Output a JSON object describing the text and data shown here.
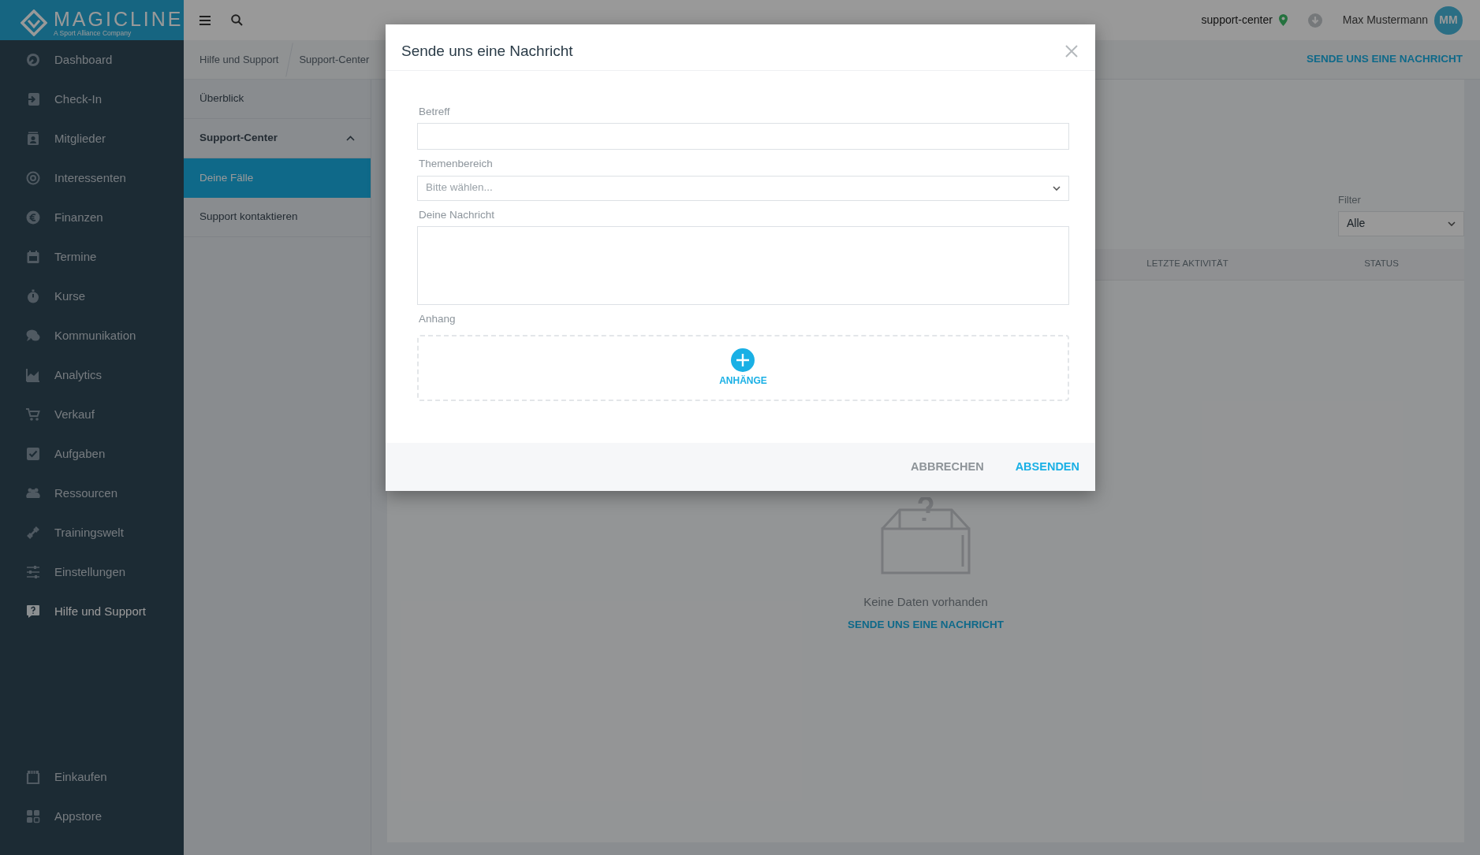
{
  "sidebar": {
    "logo": {
      "name": "MAGICLINE",
      "tagline": "A Sport Alliance Company"
    },
    "items": [
      {
        "label": "Dashboard",
        "selected": false
      },
      {
        "label": "Check-In",
        "selected": false
      },
      {
        "label": "Mitglieder",
        "selected": false
      },
      {
        "label": "Interessenten",
        "selected": false
      },
      {
        "label": "Finanzen",
        "selected": false
      },
      {
        "label": "Termine",
        "selected": false
      },
      {
        "label": "Kurse",
        "selected": false
      },
      {
        "label": "Kommunikation",
        "selected": false
      },
      {
        "label": "Analytics",
        "selected": false
      },
      {
        "label": "Verkauf",
        "selected": false
      },
      {
        "label": "Aufgaben",
        "selected": false
      },
      {
        "label": "Ressourcen",
        "selected": false
      },
      {
        "label": "Trainingswelt",
        "selected": false
      },
      {
        "label": "Einstellungen",
        "selected": false
      },
      {
        "label": "Hilfe und Support",
        "selected": true
      }
    ],
    "bottom_items": [
      {
        "label": "Einkaufen",
        "selected": false
      },
      {
        "label": "Appstore",
        "selected": false
      }
    ]
  },
  "topbar": {
    "location": "support-center",
    "user": "Max Mustermann",
    "avatar": "MM"
  },
  "breadcrumb": [
    "Hilfe und Support",
    "Support-Center"
  ],
  "header_action": "SENDE UNS EINE NACHRICHT",
  "subnav": [
    {
      "label": "Überblick",
      "kind": "link",
      "selected": false
    },
    {
      "label": "Support-Center",
      "kind": "group",
      "expanded": true,
      "children": [
        {
          "label": "Deine Fälle",
          "selected": true
        },
        {
          "label": "Support kontaktieren",
          "selected": false
        }
      ]
    }
  ],
  "filter": {
    "label": "Filter",
    "value": "Alle"
  },
  "table": {
    "columns": [
      "LETZTE AKTIVITÄT",
      "STATUS"
    ]
  },
  "empty_state": {
    "text": "Keine Daten vorhanden",
    "link": "SENDE UNS EINE NACHRICHT"
  },
  "dialog": {
    "title": "Sende uns eine Nachricht",
    "fields": [
      {
        "label": "Betreff",
        "kind": "text"
      },
      {
        "label": "Themenbereich",
        "kind": "select",
        "placeholder": "Bitte wählen..."
      },
      {
        "label": "Deine Nachricht",
        "kind": "textarea"
      },
      {
        "label": "Anhang",
        "kind": "upload",
        "button": "ANHÄNGE"
      }
    ],
    "buttons": [
      {
        "label": "ABBRECHEN",
        "kind": "secondary"
      },
      {
        "label": "ABSENDEN",
        "kind": "primary"
      }
    ]
  }
}
